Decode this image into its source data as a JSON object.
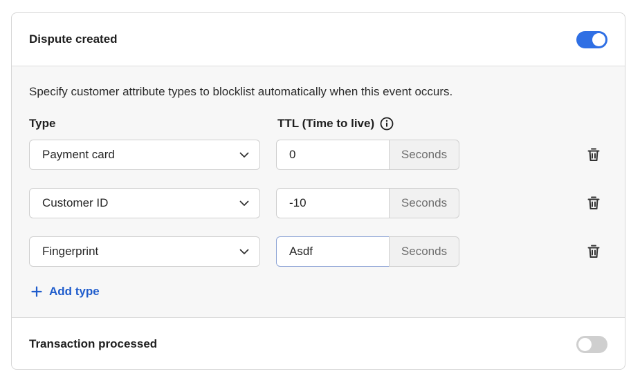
{
  "sections": {
    "dispute": {
      "title": "Dispute created",
      "enabled": true
    },
    "transaction": {
      "title": "Transaction processed",
      "enabled": false
    }
  },
  "rules": {
    "description": "Specify customer attribute types to blocklist automatically when this event occurs.",
    "type_label": "Type",
    "ttl_label": "TTL (Time to live)",
    "rows": [
      {
        "type": "Payment card",
        "ttl": "0",
        "unit": "Seconds"
      },
      {
        "type": "Customer ID",
        "ttl": "-10",
        "unit": "Seconds"
      },
      {
        "type": "Fingerprint",
        "ttl": "Asdf",
        "unit": "Seconds"
      }
    ],
    "add_label": "Add type"
  },
  "colors": {
    "accent": "#2f6fe4",
    "link": "#1f5ccc",
    "toggle_off": "#cfcfcf"
  },
  "icons": {
    "info": "info-icon",
    "chevron": "chevron-down-icon",
    "delete": "trash-icon",
    "add": "plus-icon"
  }
}
